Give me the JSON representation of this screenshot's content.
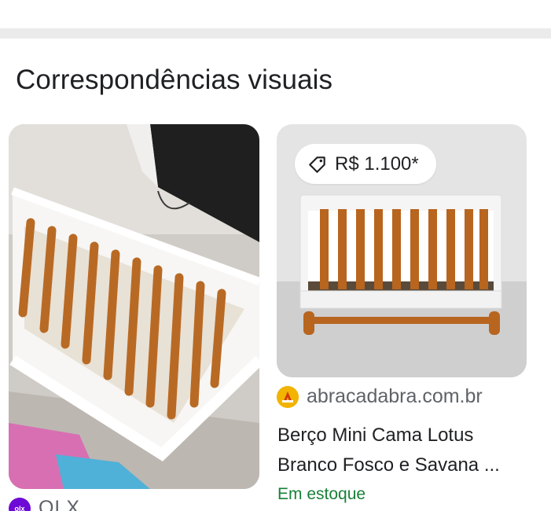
{
  "section": {
    "title": "Correspondências visuais"
  },
  "results": [
    {
      "image_description": "crib",
      "source": {
        "name": "OLX",
        "icon": "olx-logo-icon"
      }
    },
    {
      "price": "R$ 1.100*",
      "source": {
        "name": "abracadabra.com.br",
        "icon": "abracadabra-logo-icon"
      },
      "title_lines": [
        "Berço Mini Cama Lotus",
        "Branco Fosco e Savana ..."
      ],
      "stock": "Em estoque"
    }
  ],
  "colors": {
    "divider": "#ebebeb",
    "stock_green": "#188038",
    "secondary_text": "#5f6368",
    "olx_purple": "#6e0ad6",
    "abracadabra_yellow": "#f2b400"
  }
}
